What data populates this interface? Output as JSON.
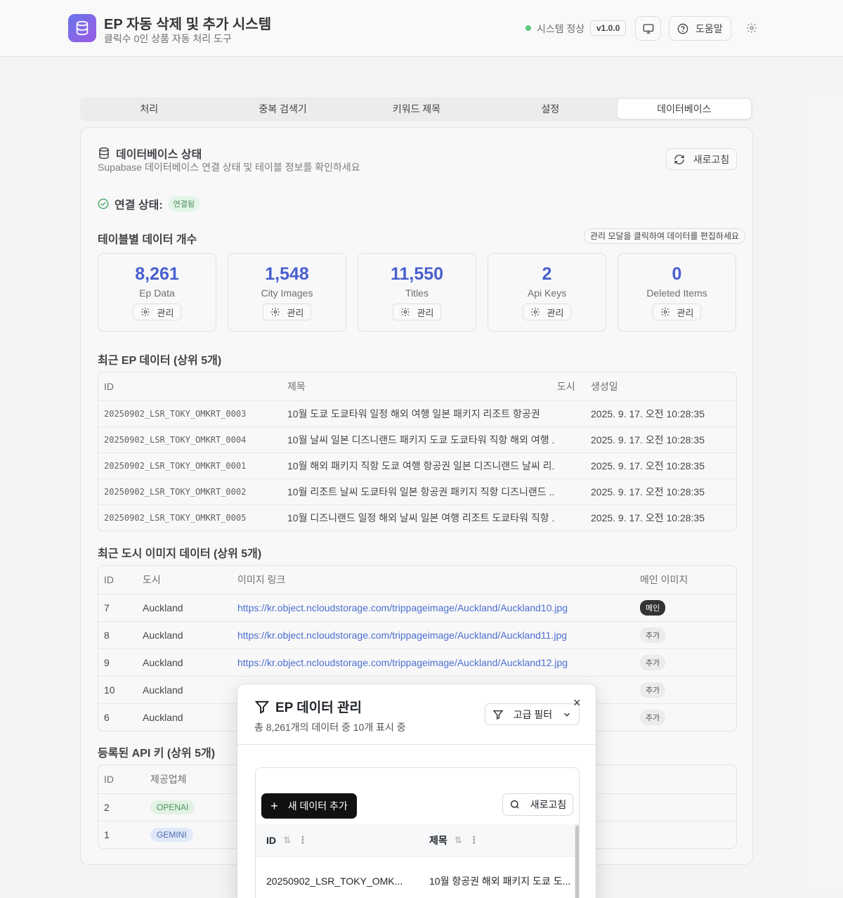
{
  "header": {
    "title": "EP 자동 삭제 및 추가 시스템",
    "subtitle": "클릭수 0인 상품 자동 처리 도구",
    "status": "시스템 정상",
    "version": "v1.0.0",
    "help_label": "도움말",
    "status_color": "#3fbf6a"
  },
  "tabs": [
    "처리",
    "중복 검색기",
    "키워드 제목",
    "설정",
    "데이터베이스"
  ],
  "db": {
    "title": "데이터베이스 상태",
    "subtitle": "Supabase 데이터베이스 연결 상태 및 테이블 정보를 확인하세요",
    "refresh_label": "새로고침",
    "connection_label": "연결 상태:",
    "connection_value": "연결됨",
    "table_counts_title": "테이블별 데이터 개수",
    "hint": "관리 모달을 클릭하여 데이터를 편집하세요",
    "manage_label": "관리",
    "stats": [
      {
        "value": "8,261",
        "label": "Ep Data"
      },
      {
        "value": "1,548",
        "label": "City Images"
      },
      {
        "value": "11,550",
        "label": "Titles"
      },
      {
        "value": "2",
        "label": "Api Keys"
      },
      {
        "value": "0",
        "label": "Deleted Items"
      }
    ]
  },
  "ep_table": {
    "title": "최근 EP 데이터 (상위 5개)",
    "columns": [
      "ID",
      "제목",
      "도시",
      "생성일"
    ],
    "rows": [
      {
        "id": "20250902_LSR_TOKY_OMKRT_0003",
        "title": "10월 도쿄 도쿄타워 일정 해외 여행 일본 패키지 리조트 항공권",
        "city": "",
        "date": "2025. 9. 17. 오전 10:28:35"
      },
      {
        "id": "20250902_LSR_TOKY_OMKRT_0004",
        "title": "10월 날씨 일본 디즈니랜드 패키지 도쿄 도쿄타워 직항 해외 여행 ...",
        "city": "",
        "date": "2025. 9. 17. 오전 10:28:35"
      },
      {
        "id": "20250902_LSR_TOKY_OMKRT_0001",
        "title": "10월 해외 패키지 직항 도쿄 여행 항공권 일본 디즈니랜드 날씨 리...",
        "city": "",
        "date": "2025. 9. 17. 오전 10:28:35"
      },
      {
        "id": "20250902_LSR_TOKY_OMKRT_0002",
        "title": "10월 리조트 날씨 도쿄타워 일본 항공권 패키지 직항 디즈니랜드 ...",
        "city": "",
        "date": "2025. 9. 17. 오전 10:28:35"
      },
      {
        "id": "20250902_LSR_TOKY_OMKRT_0005",
        "title": "10월 디즈니랜드 일정 해외 날씨 일본 여행 리조트 도쿄타워 직항 ...",
        "city": "",
        "date": "2025. 9. 17. 오전 10:28:35"
      }
    ]
  },
  "city_table": {
    "title": "최근 도시 이미지 데이터 (상위 5개)",
    "columns": [
      "ID",
      "도시",
      "이미지 링크",
      "메인 이미지"
    ],
    "rows": [
      {
        "id": "7",
        "city": "Auckland",
        "link": "https://kr.object.ncloudstorage.com/trippageimage/Auckland/Auckland10.jpg",
        "main": "메인"
      },
      {
        "id": "8",
        "city": "Auckland",
        "link": "https://kr.object.ncloudstorage.com/trippageimage/Auckland/Auckland11.jpg",
        "main": "추가"
      },
      {
        "id": "9",
        "city": "Auckland",
        "link": "https://kr.object.ncloudstorage.com/trippageimage/Auckland/Auckland12.jpg",
        "main": "추가"
      },
      {
        "id": "10",
        "city": "Auckland",
        "link": "",
        "main": "추가"
      },
      {
        "id": "6",
        "city": "Auckland",
        "link": "",
        "main": "추가"
      }
    ]
  },
  "api_table": {
    "title": "등록된 API 키 (상위 5개)",
    "columns": [
      "ID",
      "제공업체"
    ],
    "rows": [
      {
        "id": "2",
        "provider": "OPENAI"
      },
      {
        "id": "1",
        "provider": "GEMINI"
      }
    ]
  },
  "modal": {
    "title": "EP 데이터 관리",
    "subtitle": "총 8,261개의 데이터 중 10개 표시 중",
    "advanced_filter": "고급 필터",
    "close": "×",
    "add_label": "새 데이터 추가",
    "refresh_label": "새로고침",
    "columns": [
      "ID",
      "제목"
    ],
    "rows": [
      {
        "id": "20250902_LSR_TOKY_OMK...",
        "title": "10월 항공권 해외 패키지 도쿄 도..."
      }
    ]
  }
}
